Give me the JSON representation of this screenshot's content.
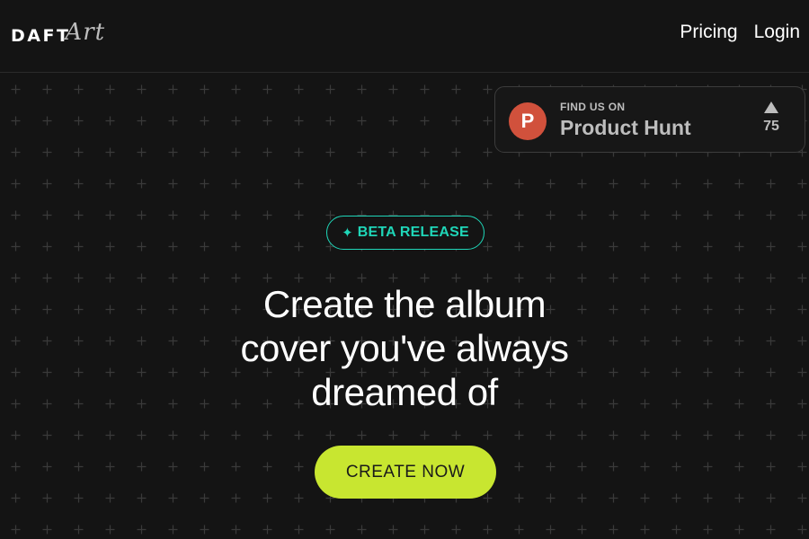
{
  "header": {
    "logo_primary": "DAFT",
    "logo_script": "Art",
    "nav": [
      {
        "label": "Pricing"
      },
      {
        "label": "Login"
      }
    ]
  },
  "product_hunt": {
    "logo_letter": "P",
    "small_label": "FIND US ON",
    "name": "Product Hunt",
    "votes": "75"
  },
  "hero": {
    "badge_icon": "✦",
    "badge_label": "BETA RELEASE",
    "headline_lines": [
      "Create the album",
      "cover you've always",
      "dreamed of"
    ],
    "cta_label": "CREATE NOW"
  },
  "colors": {
    "background": "#141414",
    "accent_teal": "#1fd6b8",
    "cta_lime": "#c8e630",
    "product_hunt_red": "#d1513c"
  }
}
